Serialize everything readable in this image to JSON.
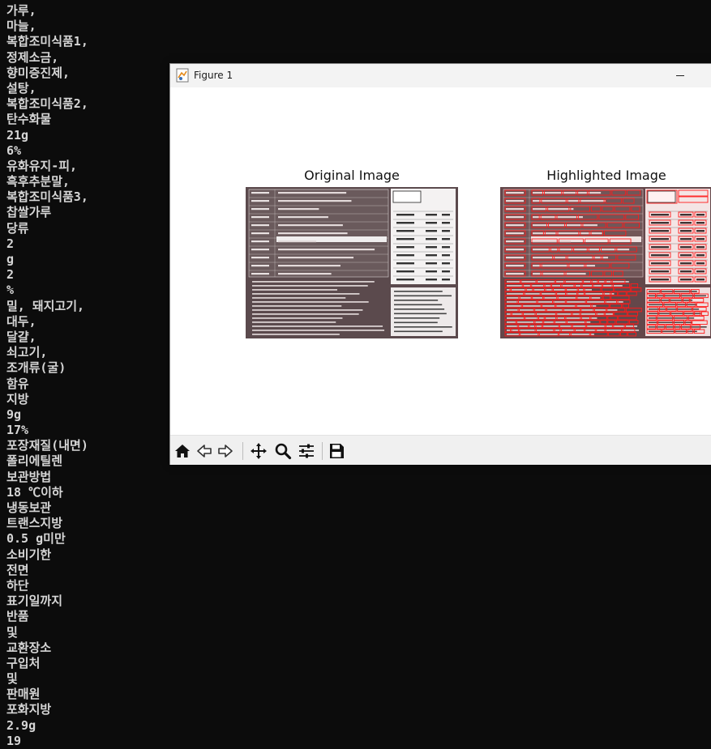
{
  "terminal": {
    "lines": [
      "가루,",
      "마늘,",
      "복합조미식품1,",
      "정제소금,",
      "향미증진제,",
      "설탕,",
      "복합조미식품2,",
      "탄수화물",
      "21g",
      "6%",
      "유화유지-피,",
      "흑후추분말,",
      "복합조미식품3,",
      "찹쌀가루",
      "당류",
      "2",
      "g",
      "2",
      "%",
      "밀, 돼지고기,",
      "대두,",
      "달걀,",
      "쇠고기,",
      "조개류(굴)",
      "함유",
      "지방",
      "9g",
      "17%",
      "포장재질(내면)",
      "폴리에틸렌",
      "보관방법",
      "18 ℃이하",
      "냉동보관",
      "트랜스지방",
      "0.5 g미만",
      "소비기한",
      "전면",
      "하단",
      "표기일까지",
      "반품",
      "및",
      "교환장소",
      "구입처",
      "및",
      "판매원",
      "포화지방",
      "2.9g",
      "19"
    ]
  },
  "window": {
    "title": "Figure 1",
    "icon": "matplotlib-figure-icon"
  },
  "figure": {
    "left_title": "Original Image",
    "right_title": "Highlighted Image"
  },
  "toolbar": {
    "icons": [
      "home-icon",
      "back-arrow-icon",
      "forward-arrow-icon",
      "pan-icon",
      "zoom-icon",
      "configure-subplots-icon",
      "save-icon"
    ]
  },
  "colors": {
    "terminal_bg": "#0c0c0c",
    "terminal_fg": "#d6d6d6",
    "highlight": "#ff1a1a",
    "label_bg": "#5a4a4c"
  }
}
